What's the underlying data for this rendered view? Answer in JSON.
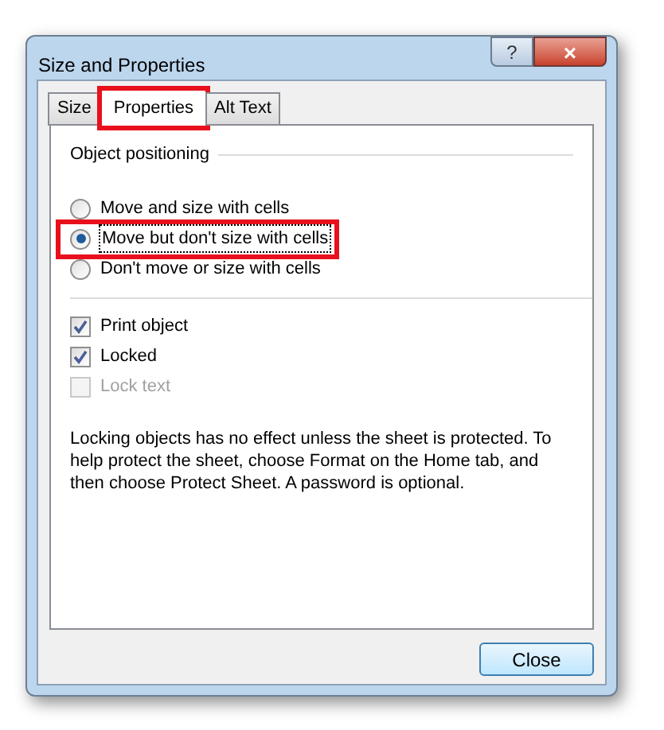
{
  "window": {
    "title": "Size and Properties",
    "buttons": [
      "?",
      "×"
    ]
  },
  "tabs": [
    {
      "label": "Size",
      "selected": false,
      "highlighted": false
    },
    {
      "label": "Properties",
      "selected": true,
      "highlighted": true
    },
    {
      "label": "Alt Text",
      "selected": false,
      "highlighted": false
    }
  ],
  "group": {
    "title": "Object positioning"
  },
  "positioning": [
    {
      "label": "Move and size with cells",
      "selected": false,
      "highlighted": false
    },
    {
      "label": "Move but don't size with cells",
      "selected": true,
      "highlighted": true
    },
    {
      "label": "Don't move or size with cells",
      "selected": false,
      "highlighted": false
    }
  ],
  "options": [
    {
      "label": "Print object",
      "checked": true,
      "disabled": false
    },
    {
      "label": "Locked",
      "checked": true,
      "disabled": false
    },
    {
      "label": "Lock text",
      "checked": false,
      "disabled": true
    }
  ],
  "note": "Locking objects has no effect unless the sheet is protected. To help protect the sheet, choose Format on the Home tab, and then choose Protect Sheet. A password is optional.",
  "close_button": "Close"
}
